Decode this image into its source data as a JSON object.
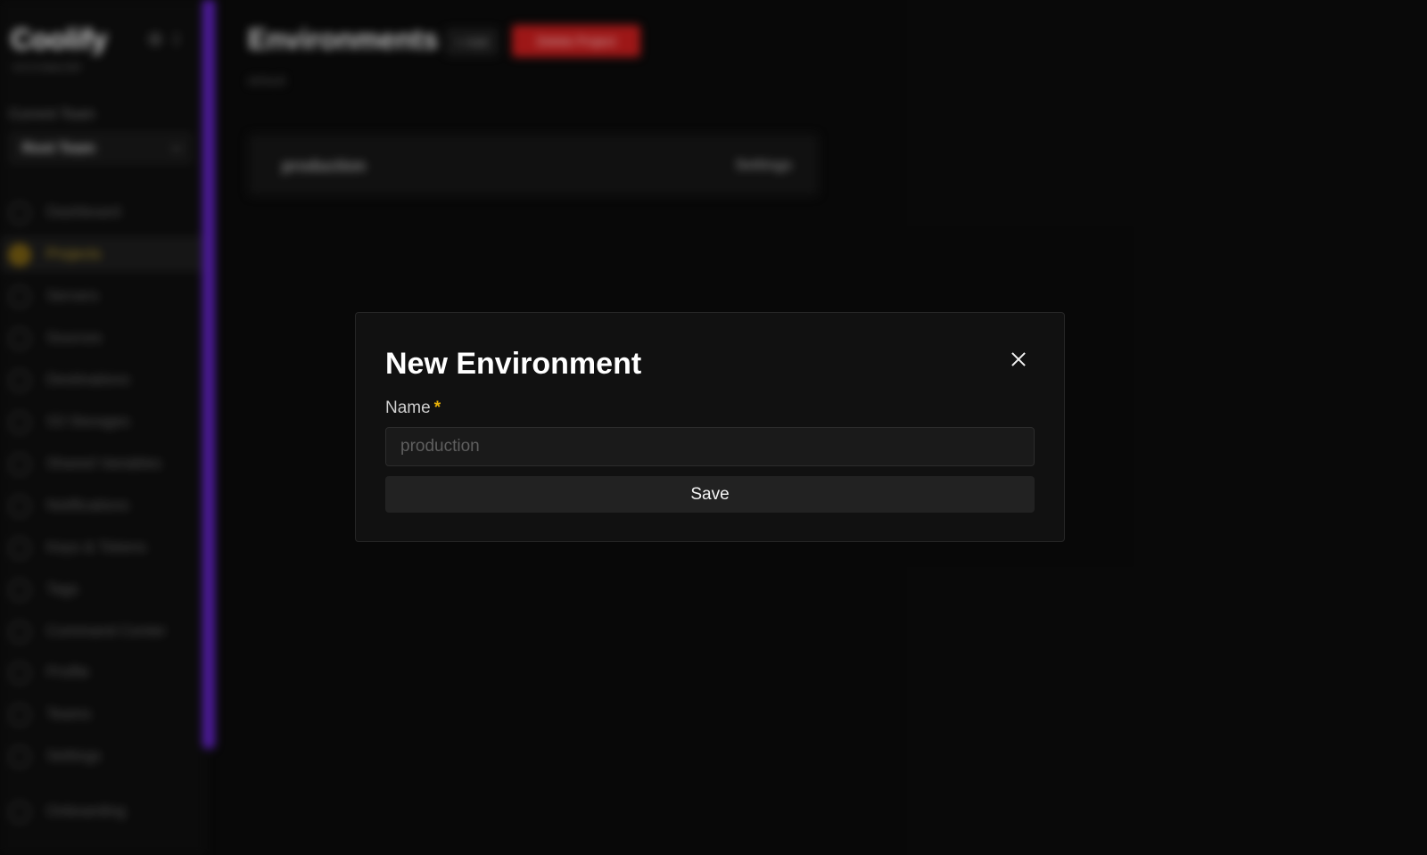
{
  "sidebar": {
    "logo": "Coolify",
    "version": "v4.0.0-beta.000",
    "team_label": "Current Team",
    "team_value": "Root Team",
    "items": [
      {
        "label": "Dashboard",
        "icon": "home-icon"
      },
      {
        "label": "Projects",
        "icon": "stack-icon"
      },
      {
        "label": "Servers",
        "icon": "server-icon"
      },
      {
        "label": "Sources",
        "icon": "git-branch-icon"
      },
      {
        "label": "Destinations",
        "icon": "network-icon"
      },
      {
        "label": "S3 Storages",
        "icon": "database-icon"
      },
      {
        "label": "Shared Variables",
        "icon": "variable-icon"
      },
      {
        "label": "Notifications",
        "icon": "bell-icon"
      },
      {
        "label": "Keys & Tokens",
        "icon": "key-icon"
      },
      {
        "label": "Tags",
        "icon": "tag-icon"
      },
      {
        "label": "Command Center",
        "icon": "terminal-icon"
      },
      {
        "label": "Profile",
        "icon": "user-icon"
      },
      {
        "label": "Teams",
        "icon": "users-icon"
      },
      {
        "label": "Settings",
        "icon": "gear-icon"
      },
      {
        "label": "Onboarding",
        "icon": "compass-icon"
      }
    ],
    "active_index": 1
  },
  "main": {
    "title": "Environments",
    "add_label": "+ Add",
    "delete_label": "Delete Project",
    "subtitle": "default",
    "environments": [
      {
        "name": "production",
        "action": "Settings"
      }
    ]
  },
  "modal": {
    "title": "New Environment",
    "field_label": "Name",
    "required_mark": "*",
    "input_placeholder": "production",
    "input_value": "",
    "save_label": "Save"
  },
  "colors": {
    "accent": "#5b21b6",
    "required": "#eab308",
    "danger": "#b91c1c",
    "active_nav": "#a58a2a"
  }
}
